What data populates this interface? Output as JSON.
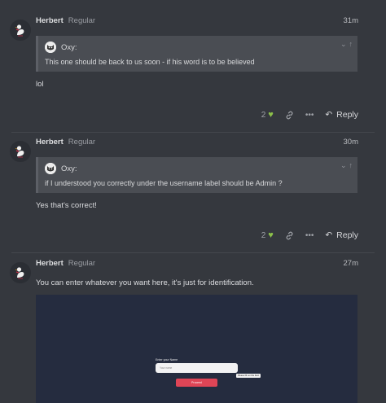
{
  "posts": [
    {
      "author": "Herbert",
      "group": "Regular",
      "time": "31m",
      "quote": {
        "author": "Oxy:",
        "text": "This one should be back to us soon - if his word is to be believed"
      },
      "body": "lol",
      "likes": "2",
      "reply_label": "Reply"
    },
    {
      "author": "Herbert",
      "group": "Regular",
      "time": "30m",
      "quote": {
        "author": "Oxy:",
        "text": "if I understood you correctly under the username label should be Admin ?"
      },
      "body": "Yes that's correct!",
      "likes": "2",
      "reply_label": "Reply"
    },
    {
      "author": "Herbert",
      "group": "Regular",
      "time": "27m",
      "body": "You can enter whatever you want here, it's just for identification.",
      "screenshot": {
        "label": "Enter your Name",
        "placeholder": "Your name",
        "tooltip": "Please fill out this field.",
        "button": "Proceed"
      }
    }
  ],
  "colors": {
    "like_heart": "#8cc04a",
    "proceed_button": "#df4556",
    "screenshot_bg": "#252c3f"
  },
  "icons": [
    "goose-avatar-icon",
    "cat-avatar-icon",
    "chevron-down-icon",
    "arrow-up-icon",
    "heart-icon",
    "link-icon",
    "more-icon",
    "reply-icon"
  ]
}
